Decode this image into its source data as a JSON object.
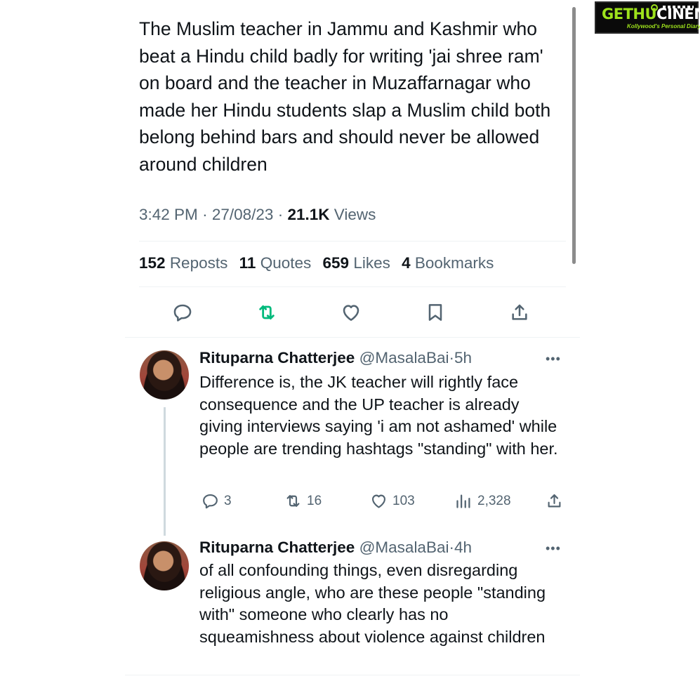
{
  "watermark": {
    "brand_a": "GETHU",
    "brand_b": "CINEMA",
    "tagline": "Kollywood's Personal Diary"
  },
  "tweet": {
    "text": "The Muslim teacher in Jammu and Kashmir who beat a Hindu child badly for writing 'jai shree ram' on board and the teacher in Muzaffarnagar who made her Hindu students slap a Muslim child both belong behind bars and should never be allowed around children",
    "time": "3:42 PM",
    "date": "27/08/23",
    "views_count": "21.1K",
    "views_label": "Views",
    "separator": "·",
    "stats": {
      "reposts_count": "152",
      "reposts_label": "Reposts",
      "quotes_count": "11",
      "quotes_label": "Quotes",
      "likes_count": "659",
      "likes_label": "Likes",
      "bookmarks_count": "4",
      "bookmarks_label": "Bookmarks"
    },
    "repost_color": "#00ba7c",
    "icon_color": "#536471"
  },
  "replies": [
    {
      "name": "Rituparna Chatterjee",
      "handle": "@MasalaBai",
      "separator": "·",
      "time": "5h",
      "more": "•••",
      "text": "Difference is, the JK teacher will rightly face consequence and the UP teacher is already giving interviews saying 'i am not ashamed' while people are trending hashtags \"standing\" with her.",
      "replies_count": "3",
      "reposts_count": "16",
      "likes_count": "103",
      "views_count": "2,328"
    },
    {
      "name": "Rituparna Chatterjee",
      "handle": "@MasalaBai",
      "separator": "·",
      "time": "4h",
      "more": "•••",
      "text": "of all confounding things, even disregarding religious angle, who are these people \"standing with\" someone who clearly has no squeamishness about violence against children"
    }
  ]
}
